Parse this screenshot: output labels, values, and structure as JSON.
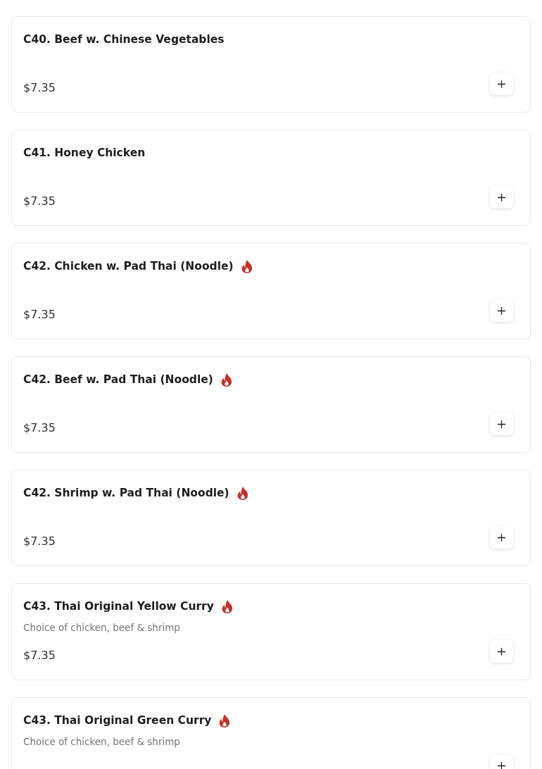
{
  "items": [
    {
      "title": "C40. Beef w. Chinese Vegetables",
      "spicy": false,
      "price": "$7.35"
    },
    {
      "title": "C41. Honey Chicken",
      "spicy": false,
      "price": "$7.35"
    },
    {
      "title": "C42. Chicken w. Pad Thai (Noodle)",
      "spicy": true,
      "price": "$7.35"
    },
    {
      "title": "C42. Beef w. Pad Thai (Noodle)",
      "spicy": true,
      "price": "$7.35"
    },
    {
      "title": "C42. Shrimp w. Pad Thai (Noodle)",
      "spicy": true,
      "price": "$7.35"
    },
    {
      "title": "C43. Thai Original Yellow Curry",
      "spicy": true,
      "description": "Choice of chicken, beef & shrimp",
      "price": "$7.35"
    },
    {
      "title": "C43. Thai Original Green Curry",
      "spicy": true,
      "description": "Choice of chicken, beef & shrimp"
    }
  ]
}
